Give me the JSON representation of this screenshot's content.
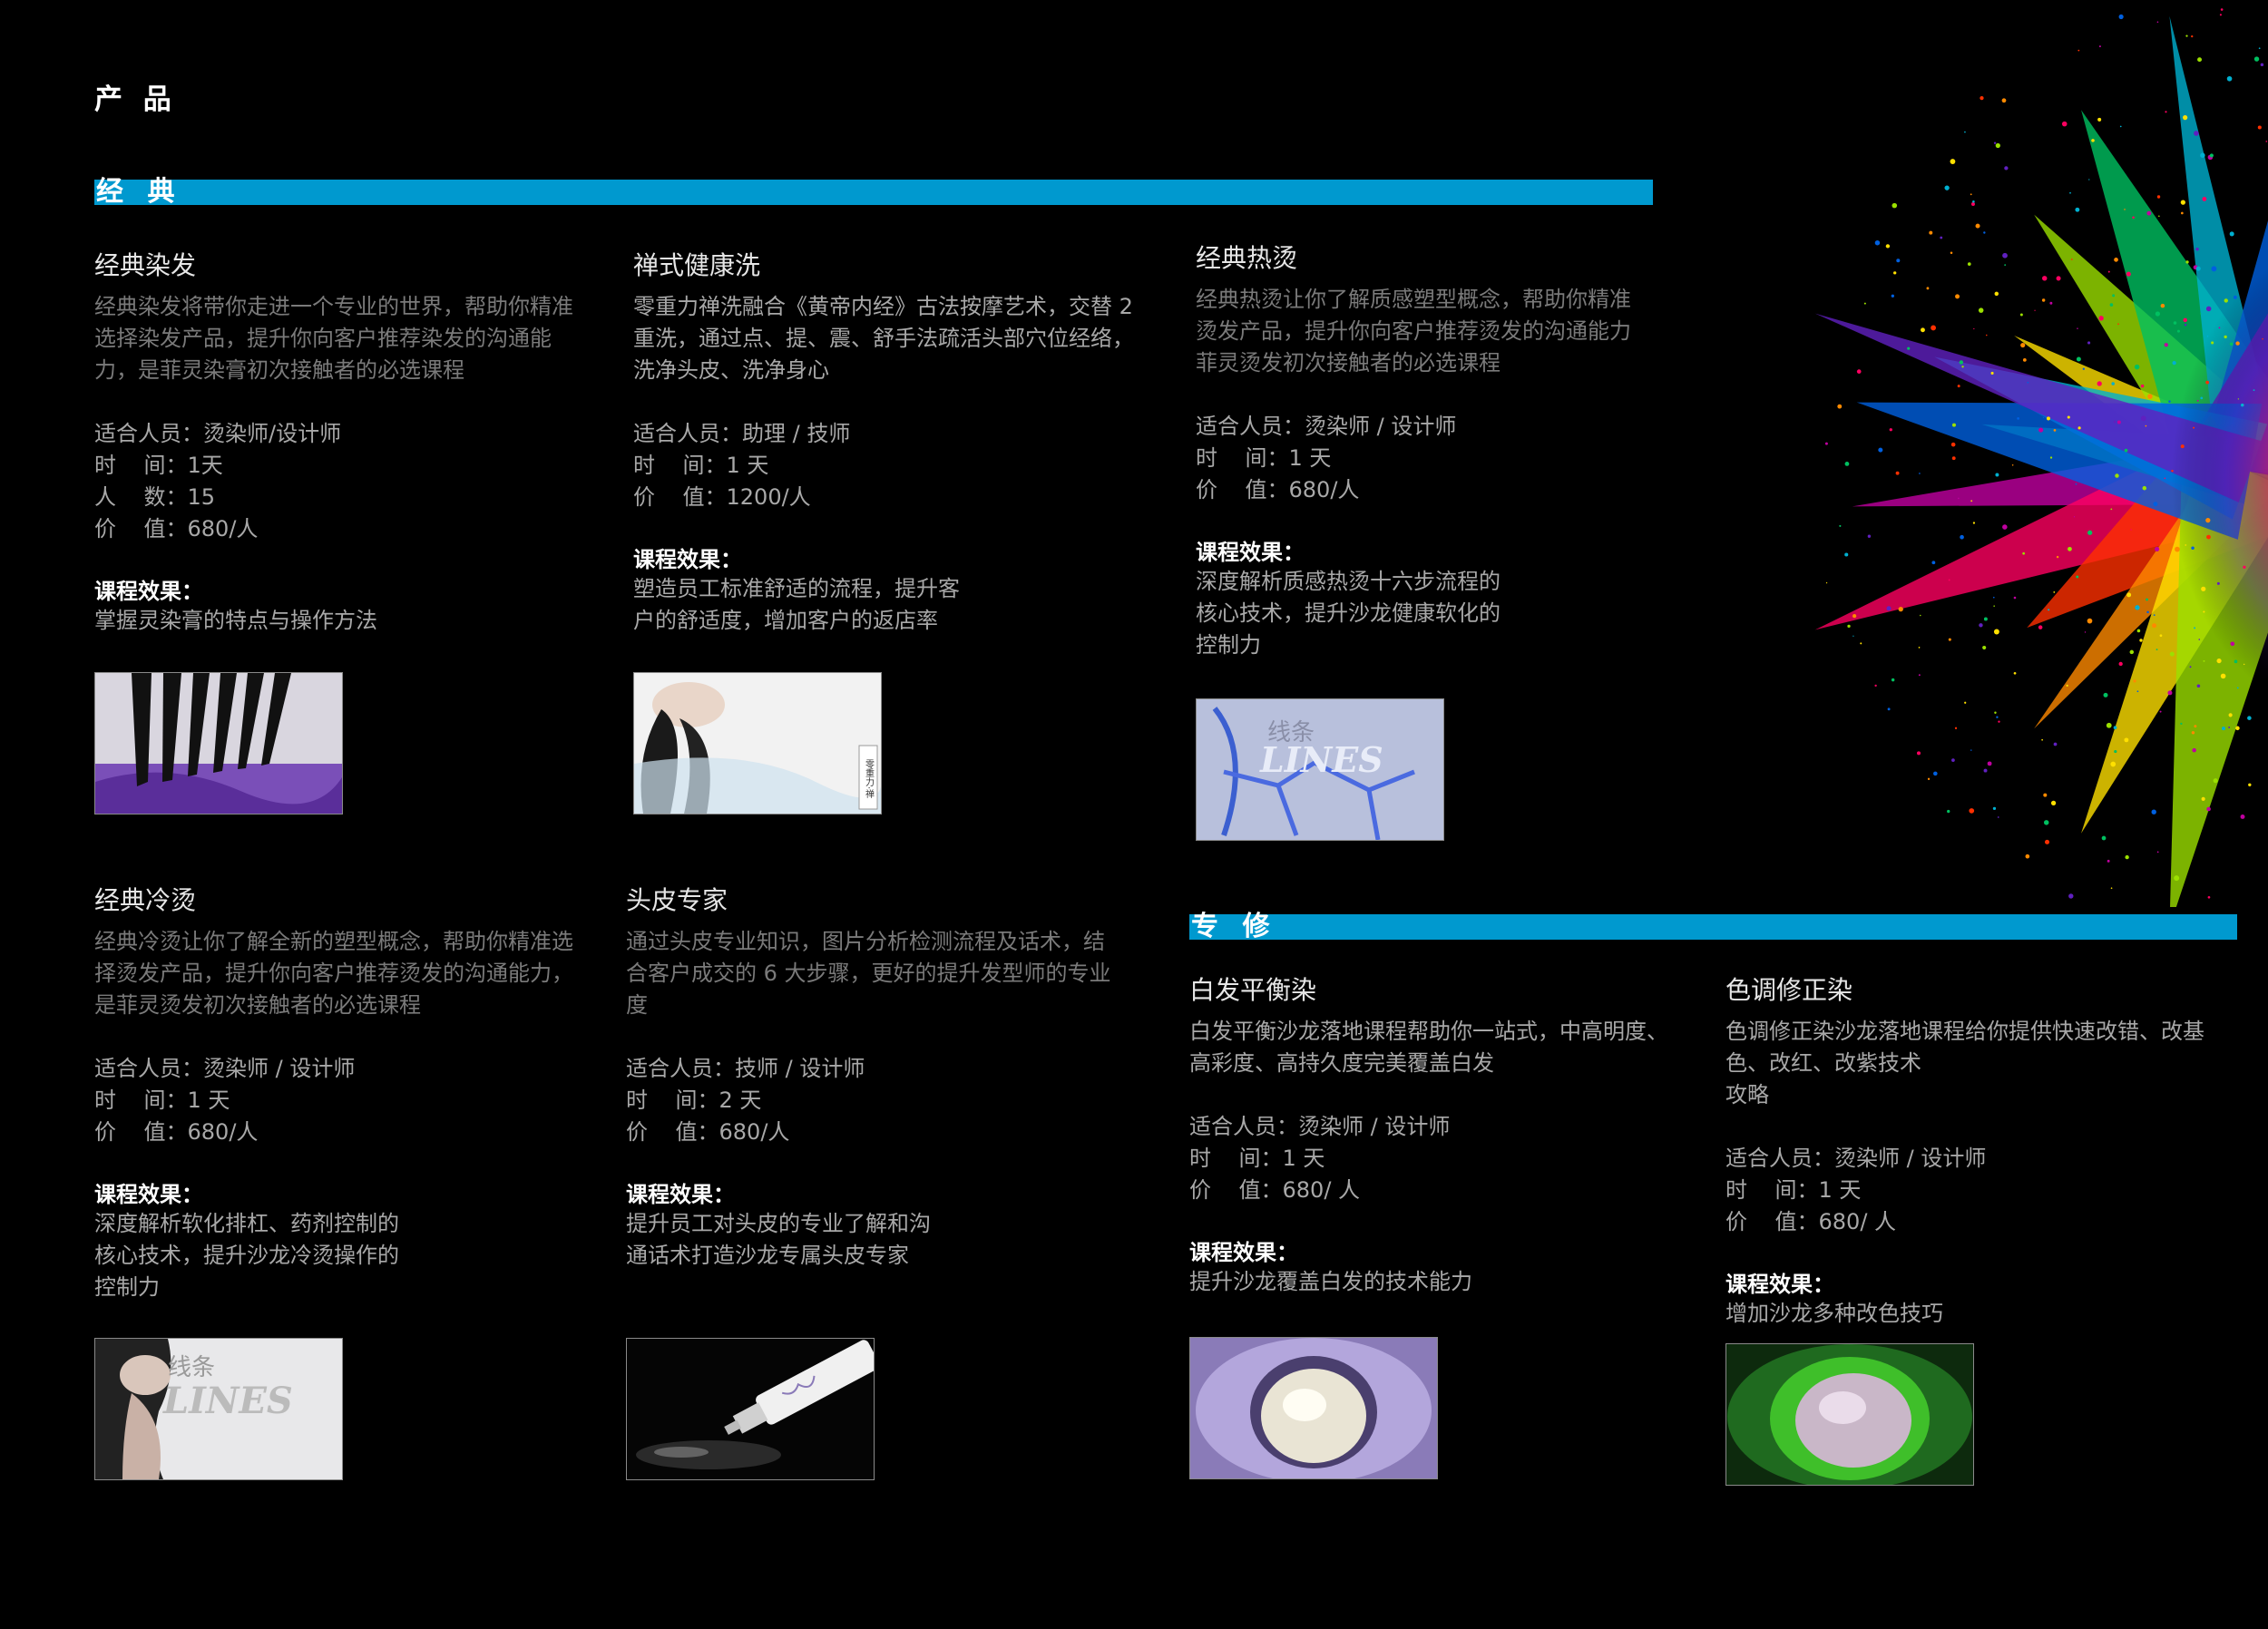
{
  "page": {
    "title": "产 品"
  },
  "sections": {
    "classic": {
      "label": "经 典"
    },
    "special": {
      "label": "专 修"
    }
  },
  "courses": {
    "dye": {
      "title": "经典染发",
      "desc": "经典染发将带你走进一个专业的世界，帮助你精准\n选择染发产品，提升你向客户推荐染发的沟通能\n力，是菲灵染膏初次接触者的必选课程",
      "info": [
        "适合人员：烫染师/设计师",
        "时    间：1天",
        "人    数：15",
        "价    值：680/人"
      ],
      "effect_title": "课程效果：",
      "effect": "掌握灵染膏的特点与操作方法",
      "thumb": "brush-purple-dye"
    },
    "zen": {
      "title": "禅式健康洗",
      "desc": "零重力禅洗融合《黄帝内经》古法按摩艺术，交替 2\n重洗，通过点、提、震、舒手法疏活头部穴位经络，\n洗净头皮、洗净身心",
      "info": [
        "适合人员：助理 / 技师",
        "时    间：1 天",
        "价    值：1200/人"
      ],
      "effect_title": "课程效果：",
      "effect": "塑造员工标准舒适的流程，提升客\n户的舒适度，增加客户的返店率",
      "thumb": "zen-wash-poster",
      "thumb_text": "零重力·禅"
    },
    "perm": {
      "title": "经典热烫",
      "desc": "经典热烫让你了解质感塑型概念，帮助你精准\n烫发产品，提升你向客户推荐烫发的沟通能力\n菲灵烫发初次接触者的必选课程",
      "info": [
        "适合人员：烫染师 / 设计师",
        "时    间：1 天",
        "价    值：680/人"
      ],
      "effect_title": "课程效果：",
      "effect": "深度解析质感热烫十六步流程的\n核心技术，提升沙龙健康软化的\n控制力",
      "thumb": "lines-blue",
      "thumb_cn": "线条",
      "thumb_en": "LINES"
    },
    "cold": {
      "title": "经典冷烫",
      "desc": "经典冷烫让你了解全新的塑型概念，帮助你精准选\n择烫发产品，提升你向客户推荐烫发的沟通能力，\n是菲灵烫发初次接触者的必选课程",
      "info": [
        "适合人员：烫染师 / 设计师",
        "时    间：1 天",
        "价    值：680/人"
      ],
      "effect_title": "课程效果：",
      "effect": "深度解析软化排杠、药剂控制的\n核心技术，提升沙龙冷烫操作的\n控制力",
      "thumb": "lines-model",
      "thumb_cn": "线条",
      "thumb_en": "LINES"
    },
    "scalp": {
      "title": "头皮专家",
      "desc": "通过头皮专业知识，图片分析检测流程及话术，结\n合客户成交的 6 大步骤，更好的提升发型师的专业\n度",
      "info": [
        "适合人员：技师 / 设计师",
        "时    间：2 天",
        "价    值：680/人"
      ],
      "effect_title": "课程效果：",
      "effect": "提升员工对头皮的专业了解和沟\n通话术打造沙龙专属头皮专家",
      "thumb": "tube-product"
    },
    "grey": {
      "title": "白发平衡染",
      "desc": "白发平衡沙龙落地课程帮助你一站式，中高明度、\n高彩度、高持久度完美覆盖白发",
      "info": [
        "适合人员：烫染师 / 设计师",
        "时    间：1 天",
        "价    值：680/ 人"
      ],
      "effect_title": "课程效果：",
      "effect": "提升沙龙覆盖白发的技术能力",
      "thumb": "cream-purple"
    },
    "tone": {
      "title": "色调修正染",
      "desc": "色调修正染沙龙落地课程给你提供快速改错、改基\n色、改红、改紫技术\n攻略",
      "info": [
        "适合人员：烫染师 / 设计师",
        "时    间：1 天",
        "价    值：680/ 人"
      ],
      "effect_title": "课程效果：",
      "effect": "增加沙龙多种改色技巧",
      "thumb": "cream-green"
    }
  },
  "colors": {
    "section_bar": "#0099cf",
    "background": "#000000",
    "muted_text": "#7a7a7a",
    "info_text": "#a8a8a8"
  },
  "decoration": "rainbow-powder-explosion"
}
